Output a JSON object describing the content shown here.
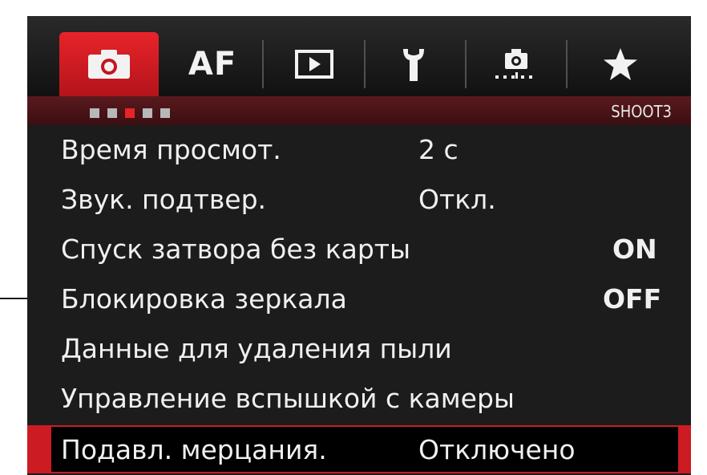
{
  "tabs": [
    {
      "name": "camera",
      "label": "",
      "icon": "camera-icon",
      "active": true
    },
    {
      "name": "af",
      "label": "AF",
      "icon": "",
      "active": false
    },
    {
      "name": "playback",
      "label": "",
      "icon": "play-icon",
      "active": false
    },
    {
      "name": "setup",
      "label": "",
      "icon": "wrench-icon",
      "active": false
    },
    {
      "name": "custom",
      "label": "",
      "icon": "custom-function-icon",
      "active": false
    },
    {
      "name": "mymenu",
      "label": "",
      "icon": "star-icon",
      "active": false
    }
  ],
  "page_indicator": {
    "count": 5,
    "active_index": 2
  },
  "page_code": "SHOOT3",
  "menu_items": [
    {
      "label": "Время просмот.",
      "value": "2 с"
    },
    {
      "label": "Звук. подтвер.",
      "value": "Откл."
    },
    {
      "label": "Спуск затвора без карты",
      "value": "ON"
    },
    {
      "label": "Блокировка зеркала",
      "value": "OFF"
    },
    {
      "label": "Данные для удаления пыли",
      "value": ""
    },
    {
      "label": "Управление вспышкой с камеры",
      "value": ""
    },
    {
      "label": "Подавл. мерцания.",
      "value": "Отключено"
    }
  ],
  "selected_index": 6,
  "colors": {
    "accent": "#cc1b22",
    "background": "#1c1c1c",
    "text": "#f0f0f0"
  }
}
